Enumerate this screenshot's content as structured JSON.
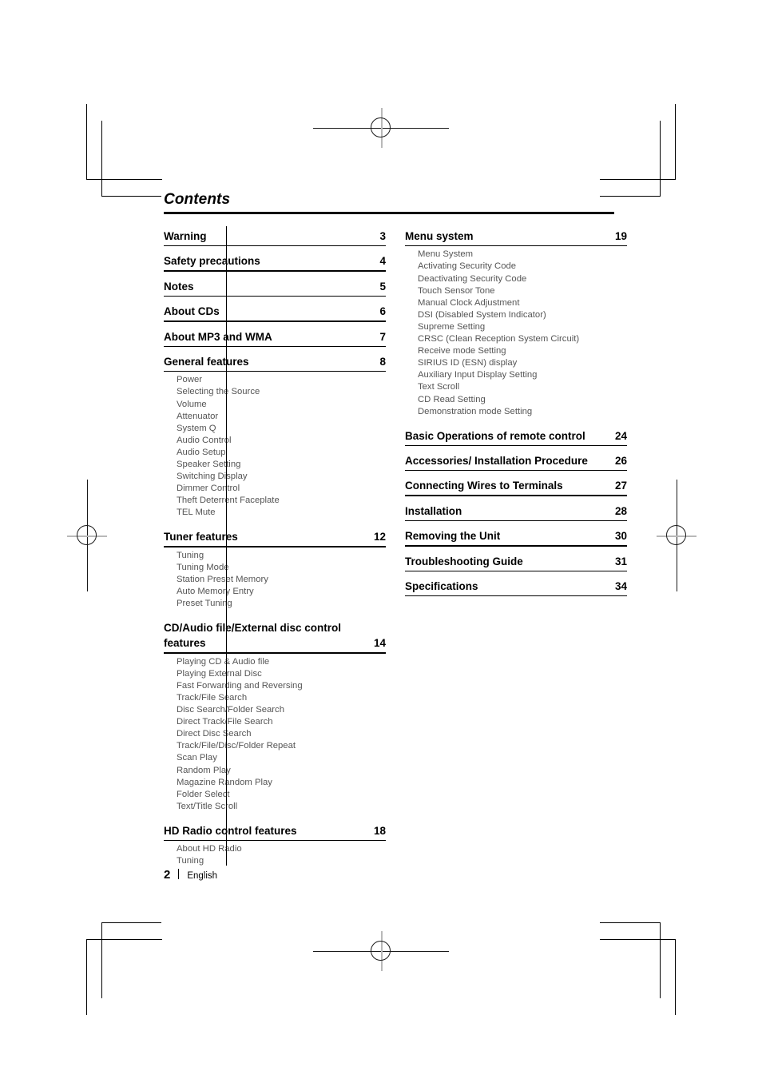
{
  "document": {
    "heading": "Contents",
    "footer": {
      "page_number": "2",
      "language": "English"
    }
  },
  "left_column": {
    "groups": [
      {
        "heading": "Warning",
        "page": "3",
        "subs": []
      },
      {
        "heading": "Safety precautions",
        "page": "4",
        "subs": []
      },
      {
        "heading": "Notes",
        "page": "5",
        "subs": []
      },
      {
        "heading": "About CDs",
        "page": "6",
        "subs": []
      },
      {
        "heading": "About MP3 and WMA",
        "page": "7",
        "subs": []
      },
      {
        "heading": "General features",
        "page": "8",
        "subs": [
          "Power",
          "Selecting the Source",
          "Volume",
          "Attenuator",
          "System Q",
          "Audio Control",
          "Audio Setup",
          "Speaker Setting",
          "Switching Display",
          "Dimmer Control",
          "Theft Deterrent Faceplate",
          "TEL Mute"
        ]
      },
      {
        "heading": "Tuner features",
        "page": "12",
        "subs": [
          "Tuning",
          "Tuning Mode",
          "Station Preset Memory",
          "Auto Memory Entry",
          "Preset Tuning"
        ]
      },
      {
        "heading_line1": "CD/Audio file/External disc control",
        "heading_line2": "features",
        "page": "14",
        "wrapped": true,
        "subs": [
          "Playing CD & Audio file",
          "Playing External Disc",
          "Fast Forwarding and Reversing",
          "Track/File Search",
          "Disc Search/Folder Search",
          "Direct Track/File Search",
          "Direct Disc Search",
          "Track/File/Disc/Folder Repeat",
          "Scan Play",
          "Random Play",
          "Magazine Random Play",
          "Folder Select",
          "Text/Title Scroll"
        ]
      },
      {
        "heading": "HD Radio control features",
        "page": "18",
        "subs": [
          "About HD Radio",
          "Tuning"
        ]
      }
    ]
  },
  "right_column": {
    "groups": [
      {
        "heading": "Menu system",
        "page": "19",
        "subs": [
          "Menu System",
          "Activating Security Code",
          "Deactivating Security Code",
          "Touch Sensor Tone",
          "Manual Clock Adjustment",
          "DSI (Disabled System Indicator)",
          "Supreme Setting",
          "CRSC (Clean Reception System Circuit)",
          "Receive mode Setting",
          "SIRIUS ID (ESN) display",
          "Auxiliary Input Display Setting",
          "Text Scroll",
          "CD Read Setting",
          "Demonstration mode Setting"
        ]
      },
      {
        "heading": "Basic Operations of remote control",
        "page": "24",
        "subs": []
      },
      {
        "heading": "Accessories/ Installation Procedure",
        "page": "26",
        "subs": []
      },
      {
        "heading": "Connecting Wires to Terminals",
        "page": "27",
        "subs": []
      },
      {
        "heading": "Installation",
        "page": "28",
        "subs": []
      },
      {
        "heading": "Removing the Unit",
        "page": "30",
        "subs": []
      },
      {
        "heading": "Troubleshooting Guide",
        "page": "31",
        "subs": []
      },
      {
        "heading": "Specifications",
        "page": "34",
        "subs": []
      }
    ]
  }
}
